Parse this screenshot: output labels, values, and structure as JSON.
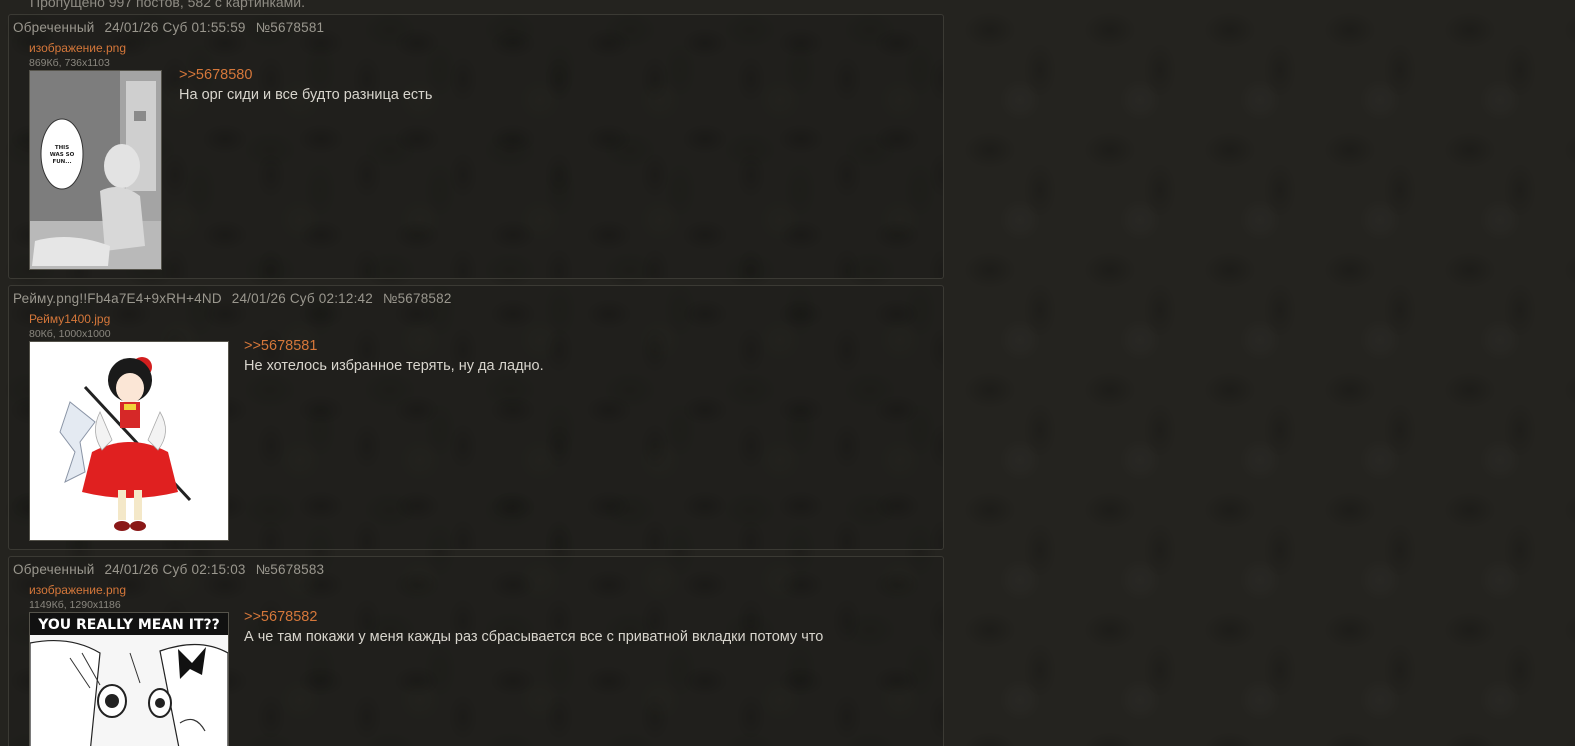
{
  "omitted_text": "Пропущено 997 постов, 582 с картинками.",
  "posts": [
    {
      "author": "Обреченный",
      "datetime": "24/01/26 Суб 01:55:59",
      "number": "№5678581",
      "file_name": "изображение.png",
      "file_meta": "869Кб, 736x1103",
      "thumb_caption": "THIS WAS SO FUN...",
      "reply_to": ">>5678580",
      "message": "На орг сиди и все будто разница есть"
    },
    {
      "author": "Рейму.png!!Fb4a7E4+9xRH+4ND",
      "datetime": "24/01/26 Суб 02:12:42",
      "number": "№5678582",
      "file_name": "Рейму1400.jpg",
      "file_meta": "80Кб, 1000x1000",
      "reply_to": ">>5678581",
      "message": "Не хотелось избранное терять, ну да ладно."
    },
    {
      "author": "Обреченный",
      "datetime": "24/01/26 Суб 02:15:03",
      "number": "№5678583",
      "file_name": "изображение.png",
      "file_meta": "1149Кб, 1290x1186",
      "thumb_caption": "YOU REALLY MEAN IT??",
      "reply_to": ">>5678582",
      "message": "А че там покажи у меня кажды раз сбрасывается все с приватной вкладки потому что"
    }
  ],
  "colors": {
    "link": "#d5773a",
    "background": "#24231f",
    "text": "#d8d5cd"
  }
}
